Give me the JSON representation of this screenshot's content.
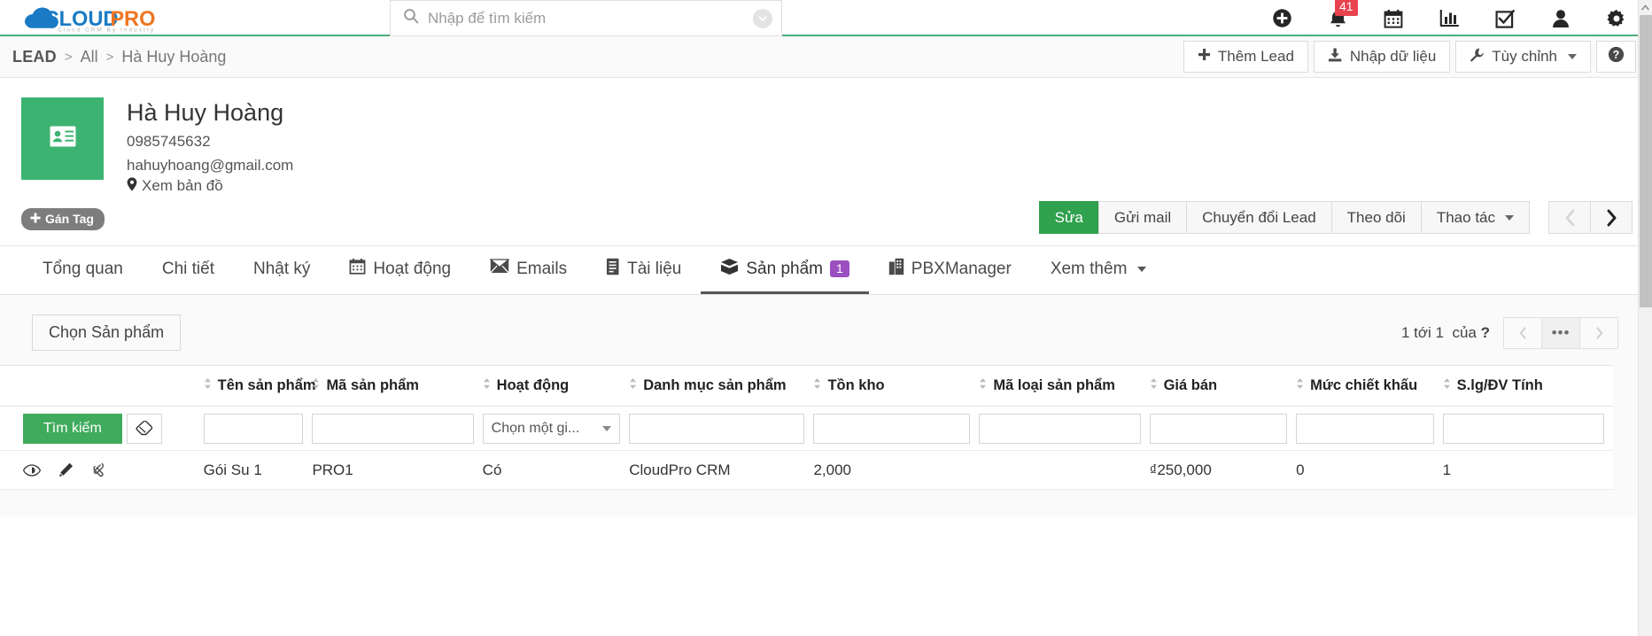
{
  "brand": {
    "name_part1": "CLOUD",
    "name_part2": "PRO",
    "tagline": "Cloud CRM By Industry",
    "color_blue": "#1a7bc4",
    "color_orange": "#ef7622",
    "accent_green": "#4caf7d"
  },
  "search": {
    "placeholder": "Nhập để tìm kiếm",
    "value": "",
    "icon": "search-icon",
    "dropdown_icon": "chevron-down-icon"
  },
  "topbar_icons": [
    {
      "name": "add-circle-icon",
      "label": ""
    },
    {
      "name": "notification-bell-icon",
      "label": "",
      "badge": "41",
      "badge_color": "#e8434e"
    },
    {
      "name": "calendar-icon",
      "label": ""
    },
    {
      "name": "chart-icon",
      "label": ""
    },
    {
      "name": "task-checkbox-icon",
      "label": ""
    },
    {
      "name": "user-icon",
      "label": ""
    },
    {
      "name": "settings-gear-icon",
      "label": ""
    }
  ],
  "breadcrumb": {
    "root": "LEAD",
    "separator": ">",
    "items": [
      "All",
      "Hà Huy Hoàng"
    ]
  },
  "breadcrumb_buttons": [
    {
      "label": "Thêm Lead",
      "icon": "plus-icon"
    },
    {
      "label": "Nhập dữ liệu",
      "icon": "import-download-icon"
    },
    {
      "label": "Tùy chỉnh",
      "icon": "wrench-icon",
      "caret": true
    },
    {
      "label": "",
      "icon": "help-question-icon"
    }
  ],
  "contact": {
    "avatar_icon": "contact-card-icon",
    "avatar_color": "#3cb371",
    "name": "Hà Huy Hoàng",
    "phone": "0985745632",
    "email": "hahuyhoang@gmail.com",
    "map_link": "Xem bản đồ",
    "map_icon": "location-pin-icon",
    "tag_button": "Gán Tag",
    "tag_icon": "plus-icon"
  },
  "record_actions": [
    {
      "label": "Sửa",
      "primary": true
    },
    {
      "label": "Gửi mail",
      "primary": false
    },
    {
      "label": "Chuyển đổi Lead",
      "primary": false
    },
    {
      "label": "Theo dõi",
      "primary": false
    },
    {
      "label": "Thao tác",
      "primary": false,
      "caret": true
    }
  ],
  "record_nav": [
    {
      "name": "prev-record-button",
      "icon": "chevron-left-icon",
      "disabled": true
    },
    {
      "name": "next-record-button",
      "icon": "chevron-right-icon",
      "disabled": false
    }
  ],
  "tabs": [
    {
      "label": "Tổng quan",
      "icon": null,
      "active": false,
      "badge": null
    },
    {
      "label": "Chi tiết",
      "icon": null,
      "active": false,
      "badge": null
    },
    {
      "label": "Nhật ký",
      "icon": null,
      "active": false,
      "badge": null
    },
    {
      "label": "Hoạt động",
      "icon": "calendar-icon",
      "active": false,
      "badge": null
    },
    {
      "label": "Emails",
      "icon": "envelope-icon",
      "active": false,
      "badge": null
    },
    {
      "label": "Tài liệu",
      "icon": "document-icon",
      "active": false,
      "badge": null
    },
    {
      "label": "Sản phẩm",
      "icon": "box-icon",
      "active": true,
      "badge": "1"
    },
    {
      "label": "PBXManager",
      "icon": "phone-icon",
      "active": false,
      "badge": null
    },
    {
      "label": "Xem thêm",
      "icon": null,
      "active": false,
      "badge": null,
      "caret": true
    }
  ],
  "panel": {
    "choose_button": "Chọn Sản phẩm",
    "pagination": {
      "range_prefix": "1 tới 1",
      "of_label": "của",
      "total": "?",
      "prev_icon": "chevron-left-icon",
      "more_icon": "ellipsis-icon",
      "next_icon": "chevron-right-icon"
    }
  },
  "table": {
    "action_column_header": "",
    "columns": [
      "Tên sản phẩm",
      "Mã sản phẩm",
      "Hoạt động",
      "Danh mục sản phẩm",
      "Tồn kho",
      "Mã loại sản phẩm",
      "Giá bán",
      "Mức chiết khấu",
      "S.lg/ĐV Tính"
    ],
    "filter_row": {
      "search_button": "Tìm kiếm",
      "clear_icon": "eraser-icon",
      "values": [
        "",
        "",
        "",
        "",
        "",
        "",
        "",
        "",
        ""
      ],
      "select_placeholder": "Chọn một gi...",
      "select_index": 2
    },
    "rows": [
      {
        "row_icons": [
          "view-eye-icon",
          "edit-pencil-icon",
          "link-paperclip-icon"
        ],
        "cells": [
          "Gói Su 1",
          "PRO1",
          "Có",
          "CloudPro CRM",
          "2,000",
          "",
          "₫250,000",
          "0",
          "1"
        ]
      }
    ]
  },
  "scrollbar": {
    "up_icon": "chevron-up-icon"
  }
}
